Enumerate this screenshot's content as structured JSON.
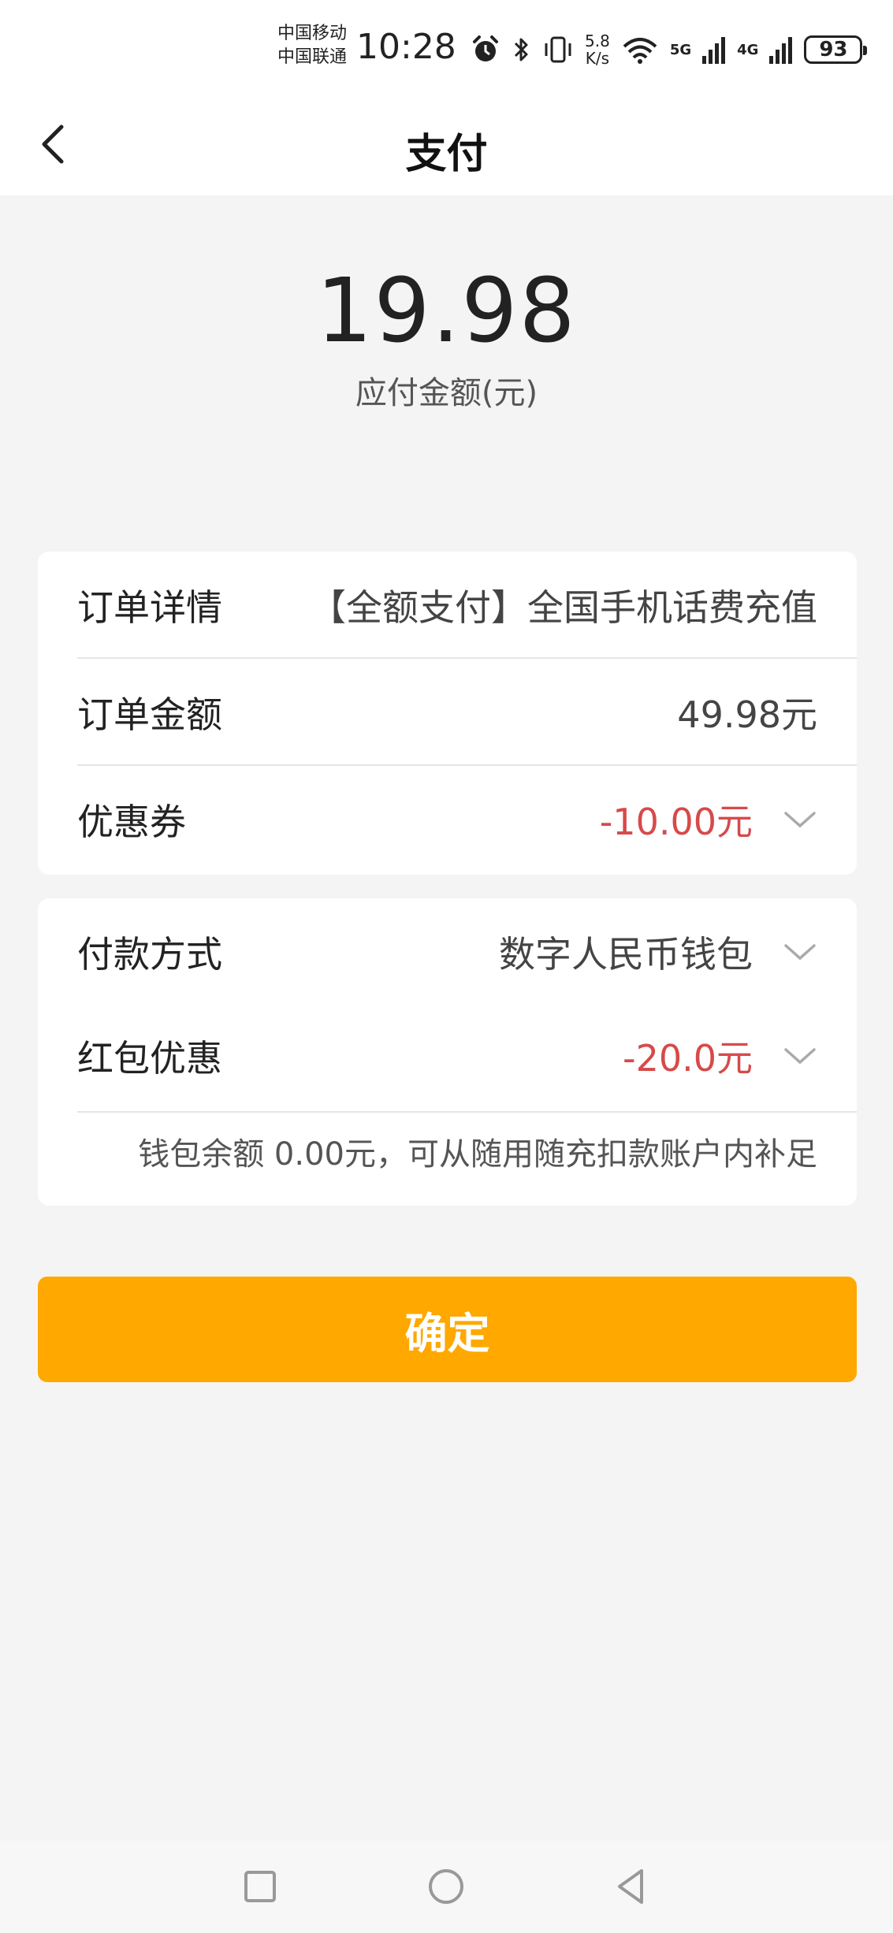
{
  "status_bar": {
    "carrier_1": "中国移动",
    "carrier_2": "中国联通",
    "time": "10:28",
    "net_speed_value": "5.8",
    "net_speed_unit": "K/s",
    "sim1_band": "5G",
    "sim2_band": "4G",
    "battery": "93"
  },
  "header": {
    "title": "支付",
    "back_icon": "chevron-left-icon"
  },
  "payment": {
    "amount": "19.98",
    "amount_label": "应付金额(元)"
  },
  "order_card": {
    "detail_label": "订单详情",
    "detail_value": "【全额支付】全国手机话费充值",
    "amount_label": "订单金额",
    "amount_value": "49.98元",
    "coupon_label": "优惠券",
    "coupon_value": "-10.00元"
  },
  "method_card": {
    "method_label": "付款方式",
    "method_value": "数字人民币钱包",
    "redpack_label": "红包优惠",
    "redpack_value": "-20.0元",
    "balance_note": "钱包余额  0.00元，可从随用随充扣款账户内补足"
  },
  "confirm_button": "确定",
  "colors": {
    "accent": "#fea800",
    "discount": "#d64a4a",
    "background": "#f4f4f4"
  },
  "nav_bar": [
    "square-recent-icon",
    "circle-home-icon",
    "triangle-back-icon"
  ]
}
